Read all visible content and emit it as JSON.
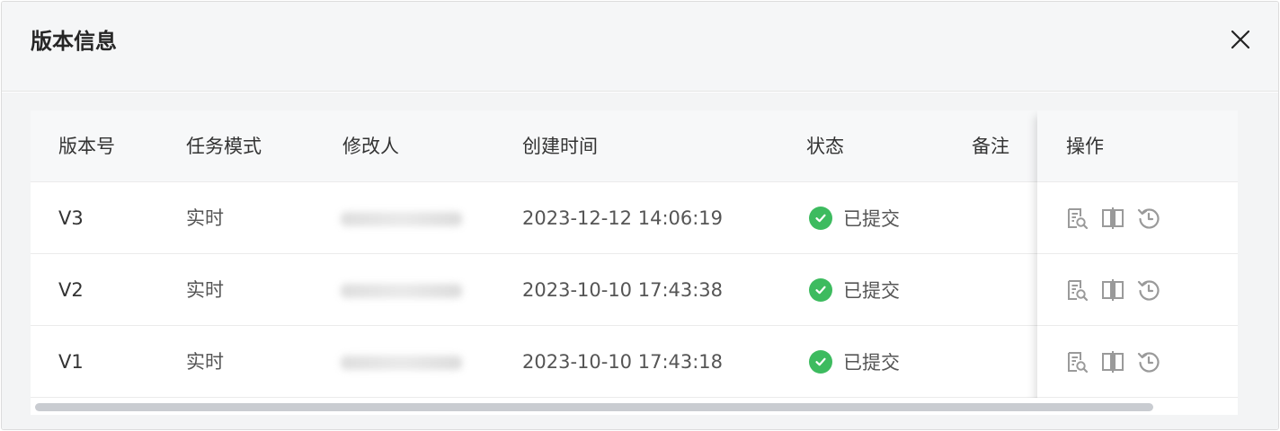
{
  "dialog": {
    "title": "版本信息",
    "close_icon": "close-icon"
  },
  "table": {
    "columns": {
      "version": "版本号",
      "mode": "任务模式",
      "modifier": "修改人",
      "created": "创建时间",
      "status": "状态",
      "remark": "备注",
      "actions": "操作"
    },
    "rows": [
      {
        "version": "V3",
        "mode": "实时",
        "created": "2023-12-12 14:06:19",
        "status": "已提交",
        "remark": ""
      },
      {
        "version": "V2",
        "mode": "实时",
        "created": "2023-10-10 17:43:38",
        "status": "已提交",
        "remark": ""
      },
      {
        "version": "V1",
        "mode": "实时",
        "created": "2023-10-10 17:43:18",
        "status": "已提交",
        "remark": ""
      }
    ],
    "action_icons": [
      "view-detail-icon",
      "compare-icon",
      "rollback-icon"
    ]
  },
  "colors": {
    "success": "#3dbb5f",
    "header_bg": "#f5f6f7",
    "icon_gray": "#9a9a9a"
  }
}
